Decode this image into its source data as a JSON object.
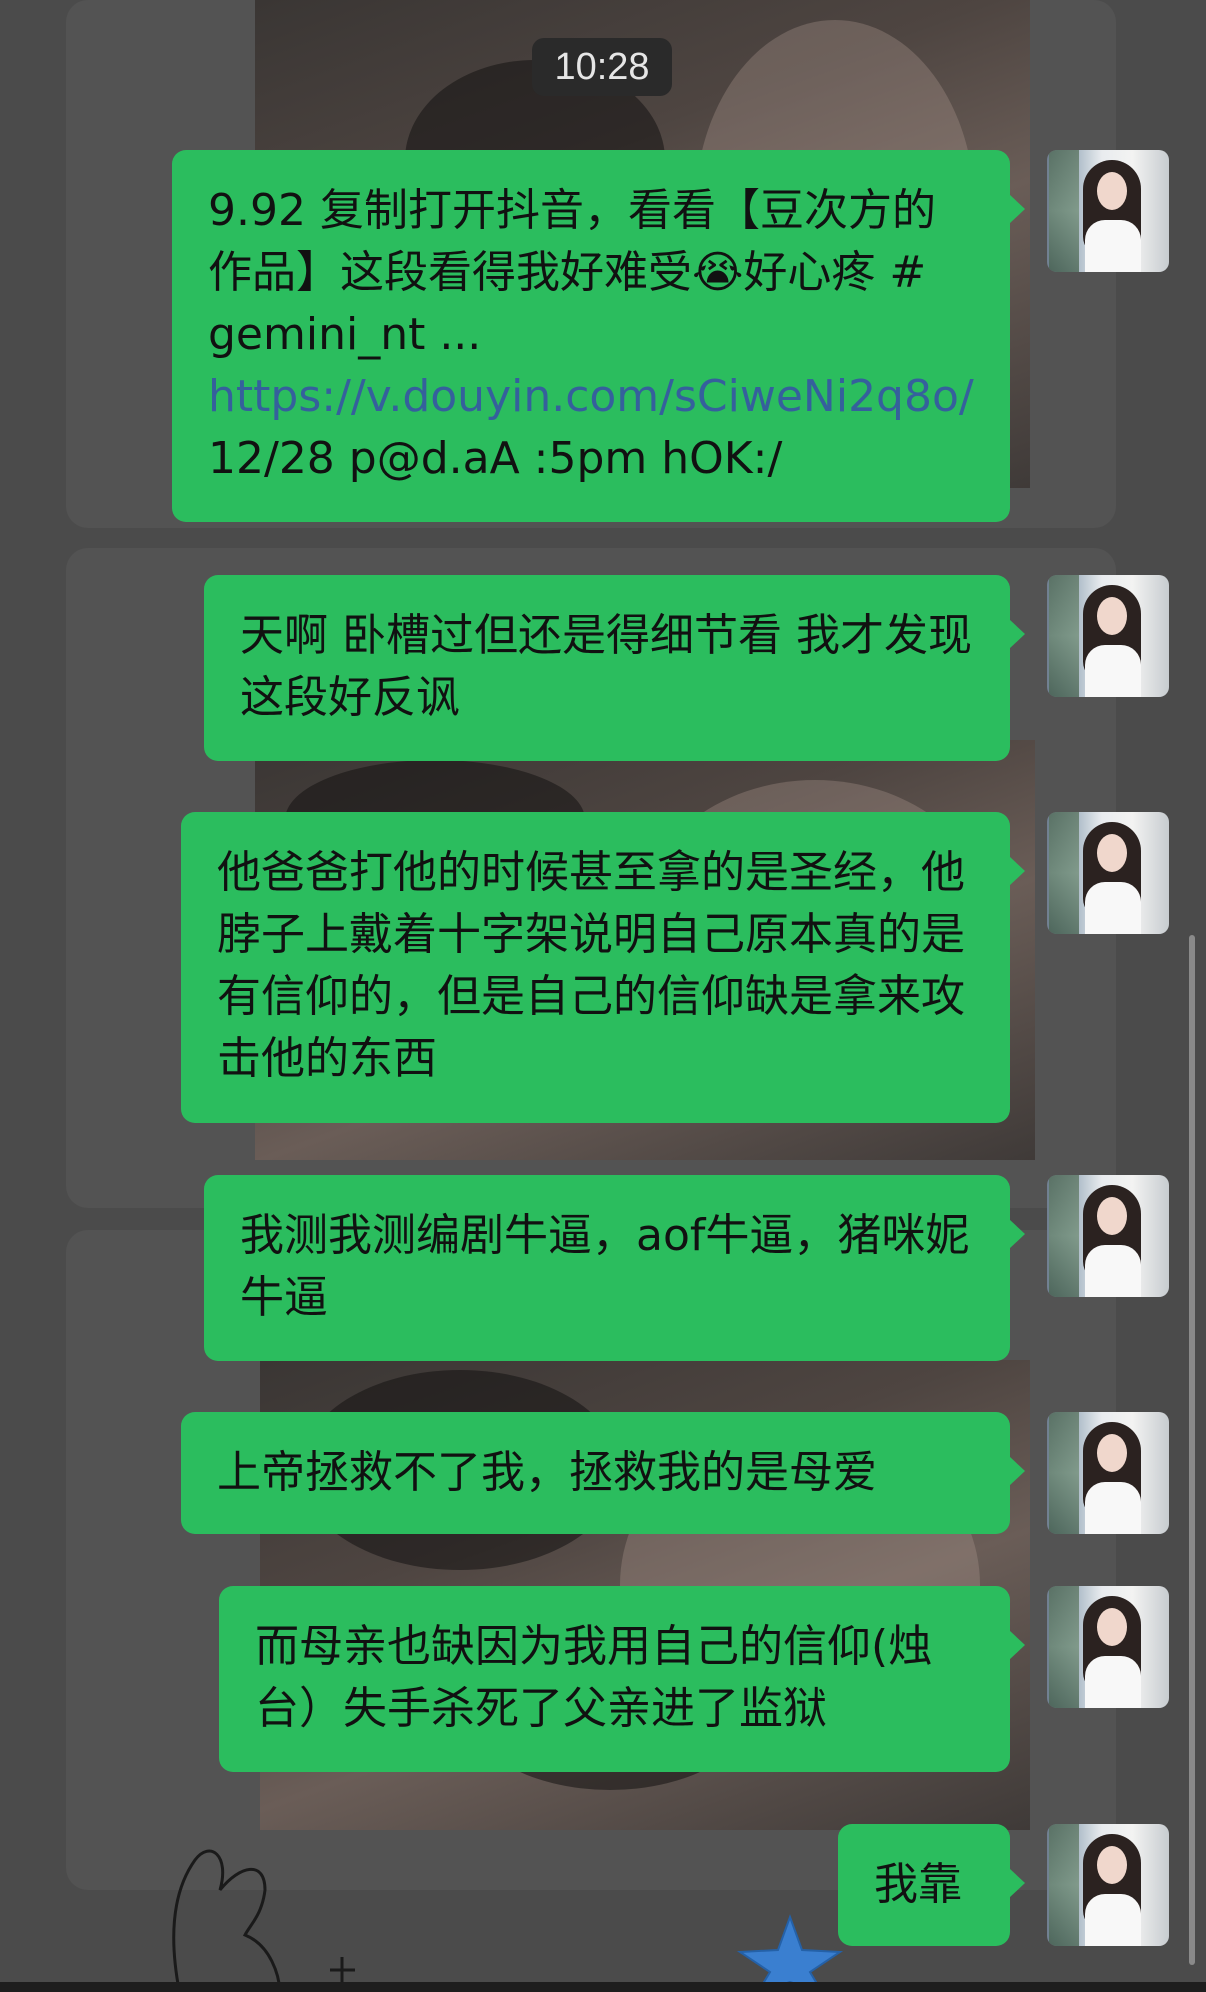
{
  "chat": {
    "timestamp": "10:28",
    "messages": [
      {
        "parts": [
          {
            "text": "9.92 复制打开抖音，看看【豆次方的作品】这段看得我好难受😭好心疼 # gemini_nt ... ",
            "link": false
          },
          {
            "text": "https://v.douyin.com/sCiweNi2q8o/",
            "link": true
          },
          {
            "text": " 12/28 p@d.aA :5pm hOK:/",
            "link": false
          }
        ]
      },
      {
        "text": "天啊 卧槽过但还是得细节看 我才发现这段好反讽"
      },
      {
        "text": "他爸爸打他的时候甚至拿的是圣经，他脖子上戴着十字架说明自己原本真的是有信仰的，但是自己的信仰缺是拿来攻击他的东西"
      },
      {
        "text": "我测我测编剧牛逼，aof牛逼，猪咪妮牛逼"
      },
      {
        "text": "上帝拯救不了我，拯救我的是母爱"
      },
      {
        "text": "而母亲也缺因为我用自己的信仰(烛台）失手杀死了父亲进了监狱"
      },
      {
        "text": "我靠"
      }
    ]
  },
  "colors": {
    "bubble": "#2bbd5e",
    "link": "#35609c",
    "background": "#4b4b4b"
  },
  "icons": [
    "user-avatar",
    "bunny-sticker",
    "star-sticker"
  ]
}
